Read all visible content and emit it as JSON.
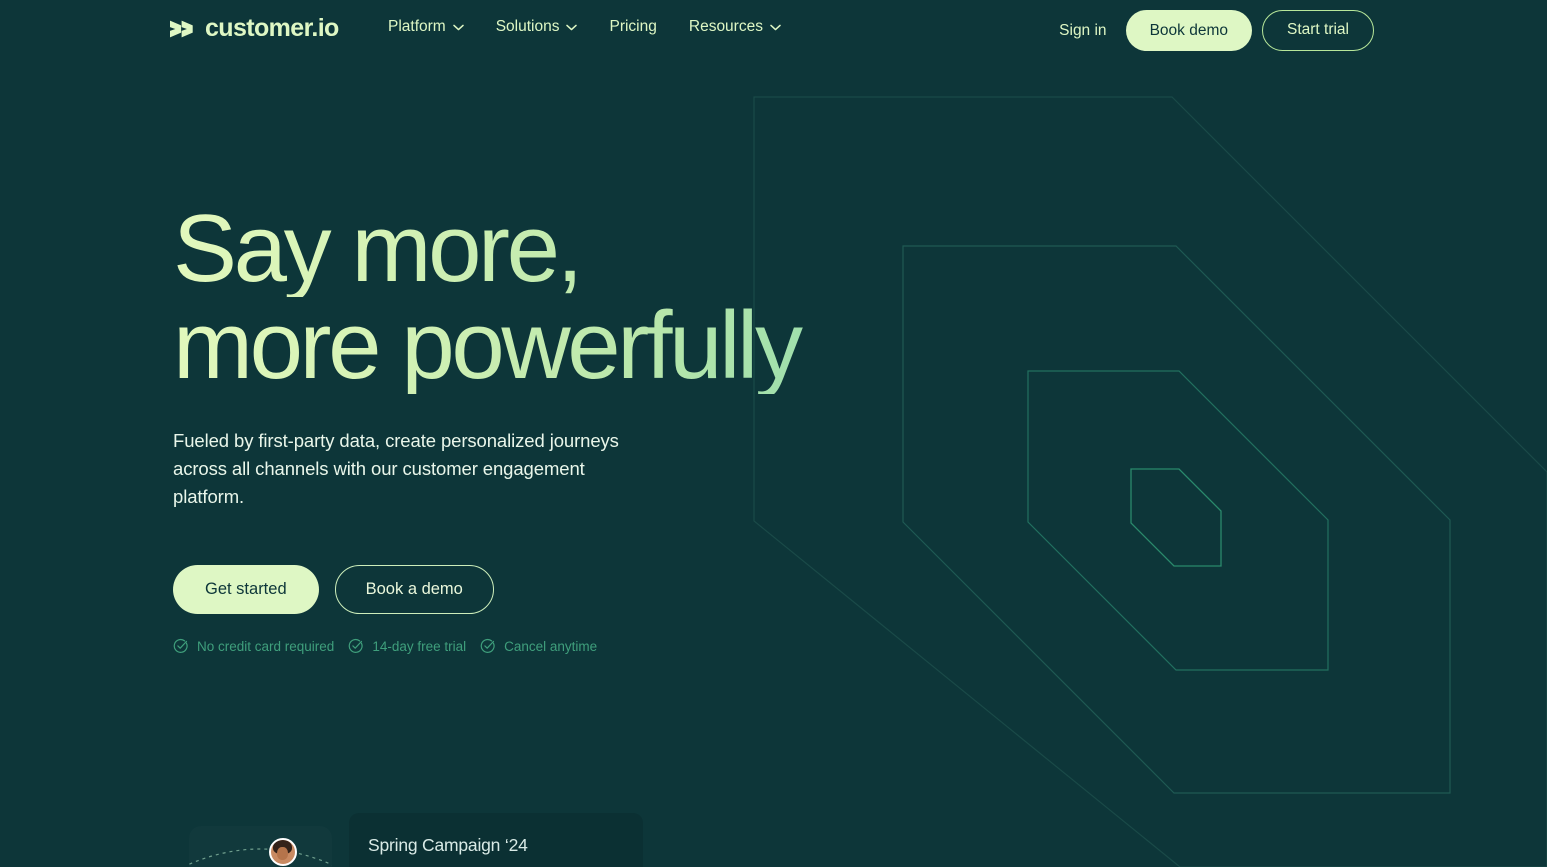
{
  "brand": {
    "logo_text": "customer.io",
    "logo_icon": "customerio-chevrons-icon",
    "accent_light": "#def7c4",
    "accent_mint": "#8ad9ab",
    "background": "#0d3639",
    "muted_green": "#3f9f7c"
  },
  "header": {
    "nav": [
      {
        "label": "Platform",
        "has_dropdown": true,
        "icon": "chevron-down-icon"
      },
      {
        "label": "Solutions",
        "has_dropdown": true,
        "icon": "chevron-down-icon"
      },
      {
        "label": "Pricing",
        "has_dropdown": false,
        "icon": ""
      },
      {
        "label": "Resources",
        "has_dropdown": true,
        "icon": "chevron-down-icon"
      }
    ],
    "sign_in": "Sign in",
    "book_demo": "Book demo",
    "start_trial": "Start trial"
  },
  "hero": {
    "headline_line1": "Say more,",
    "headline_line2": "more powerfully",
    "subheading": "Fueled by first-party data, create personalized journeys across all channels with our customer engagement platform.",
    "cta_primary": "Get started",
    "cta_secondary": "Book a demo",
    "badges": [
      {
        "label": "No credit card required",
        "icon": "check-circle-icon"
      },
      {
        "label": "14-day free trial",
        "icon": "check-circle-icon"
      },
      {
        "label": "Cancel anytime",
        "icon": "check-circle-icon"
      }
    ]
  },
  "cards": {
    "avatar_card": {
      "icon": "avatar",
      "arc": "dashed-arc"
    },
    "campaign_card": {
      "title": "Spring Campaign ‘24"
    }
  }
}
